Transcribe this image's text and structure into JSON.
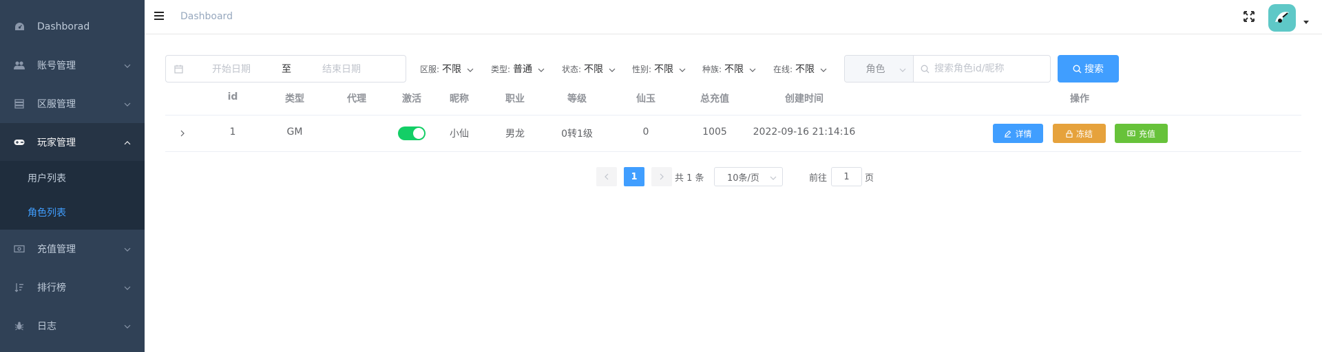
{
  "sidebar": {
    "items": [
      {
        "label": "Dashborad",
        "icon": "dashboard-icon"
      },
      {
        "label": "账号管理",
        "icon": "users-icon"
      },
      {
        "label": "区服管理",
        "icon": "server-icon"
      },
      {
        "label": "玩家管理",
        "icon": "gamepad-icon"
      },
      {
        "label": "充值管理",
        "icon": "money-icon"
      },
      {
        "label": "排行榜",
        "icon": "sort-icon"
      },
      {
        "label": "日志",
        "icon": "bug-icon"
      }
    ],
    "sub_items": [
      {
        "label": "用户列表"
      },
      {
        "label": "角色列表"
      }
    ]
  },
  "navbar": {
    "breadcrumb": "Dashboard"
  },
  "filters": {
    "date_start_placeholder": "开始日期",
    "date_separator": "至",
    "date_end_placeholder": "结束日期",
    "region": {
      "label": "区服:",
      "value": "不限"
    },
    "type": {
      "label": "类型:",
      "value": "普通"
    },
    "status": {
      "label": "状态:",
      "value": "不限"
    },
    "gender": {
      "label": "性别:",
      "value": "不限"
    },
    "race": {
      "label": "种族:",
      "value": "不限"
    },
    "online": {
      "label": "在线:",
      "value": "不限"
    },
    "search_field": "角色",
    "search_placeholder": "搜索角色id/昵称",
    "search_button": "搜索"
  },
  "table": {
    "columns": [
      "id",
      "类型",
      "代理",
      "激活",
      "昵称",
      "职业",
      "等级",
      "仙玉",
      "总充值",
      "创建时间",
      "操作"
    ],
    "rows": [
      {
        "id": "1",
        "type": "GM",
        "agent": "",
        "active": true,
        "nickname": "小仙",
        "profession": "男龙",
        "level": "0转1级",
        "jade": "0",
        "total_recharge": "1005",
        "created_at": "2022-09-16 21:14:16",
        "actions": [
          "详情",
          "冻结",
          "充值"
        ]
      }
    ]
  },
  "pagination": {
    "current_page": "1",
    "total_text": "共 1 条",
    "page_size": "10条/页",
    "goto_label": "前往",
    "goto_value": "1",
    "goto_suffix": "页"
  },
  "colors": {
    "sidebar_bg": "#304156",
    "primary": "#409eff",
    "warning": "#e6a23c",
    "success": "#67c23a",
    "switch_on": "#13ce66"
  }
}
